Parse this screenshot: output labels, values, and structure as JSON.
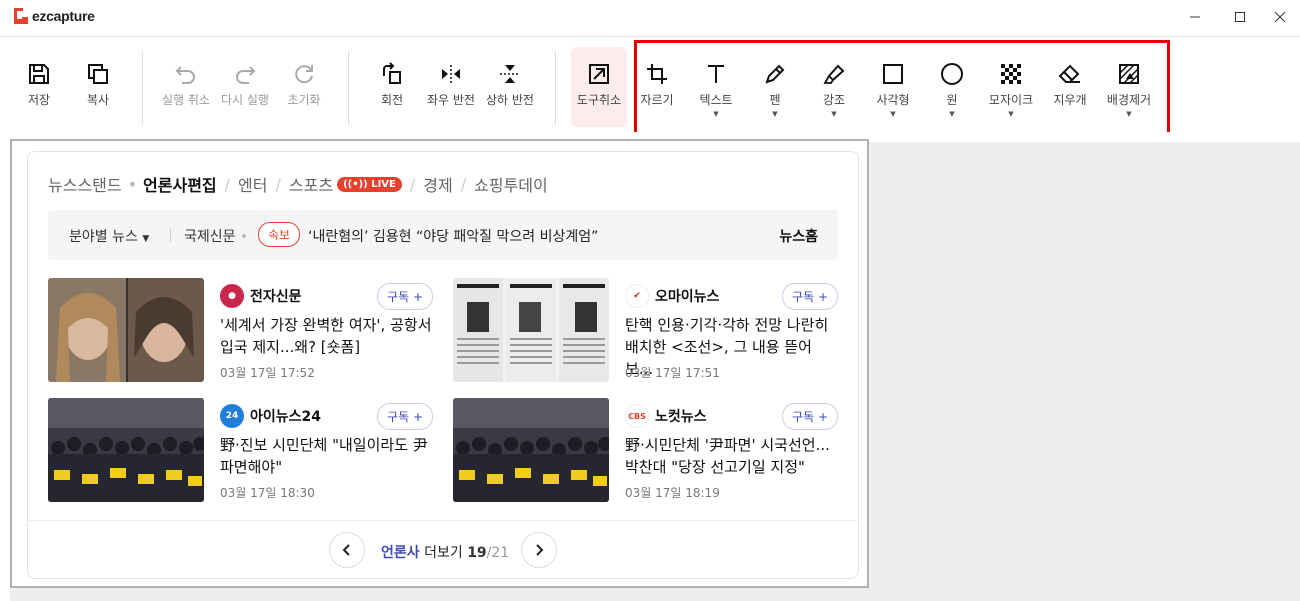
{
  "app": {
    "title": "ezcapture",
    "window_buttons": [
      "minimize-icon",
      "maximize-icon",
      "close-icon"
    ]
  },
  "toolbar": {
    "file_tools": [
      {
        "label": "저장",
        "icon": "save-icon",
        "enabled": true
      },
      {
        "label": "복사",
        "icon": "copy-icon",
        "enabled": true
      }
    ],
    "history_tools": [
      {
        "label": "실행 취소",
        "icon": "undo-icon",
        "enabled": false
      },
      {
        "label": "다시 실행",
        "icon": "redo-icon",
        "enabled": false
      },
      {
        "label": "초기화",
        "icon": "reset-icon",
        "enabled": false
      }
    ],
    "transform_tools": [
      {
        "label": "회전",
        "icon": "rotate-icon"
      },
      {
        "label": "좌우 반전",
        "icon": "flip-horizontal-icon"
      },
      {
        "label": "상하 반전",
        "icon": "flip-vertical-icon"
      }
    ],
    "cancel_tool": {
      "label": "도구취소",
      "icon": "cancel-tool-icon"
    },
    "edit_tools": [
      {
        "label": "자르기",
        "icon": "crop-icon",
        "dropdown": false
      },
      {
        "label": "텍스트",
        "icon": "text-icon",
        "dropdown": true
      },
      {
        "label": "펜",
        "icon": "pen-icon",
        "dropdown": true
      },
      {
        "label": "강조",
        "icon": "highlighter-icon",
        "dropdown": true
      },
      {
        "label": "사각형",
        "icon": "rectangle-icon",
        "dropdown": true
      },
      {
        "label": "원",
        "icon": "circle-icon",
        "dropdown": true
      },
      {
        "label": "모자이크",
        "icon": "mosaic-icon",
        "dropdown": true
      },
      {
        "label": "지우개",
        "icon": "eraser-icon",
        "dropdown": false
      },
      {
        "label": "배경제거",
        "icon": "remove-background-icon",
        "dropdown": true
      }
    ],
    "highlight_color": "#e60000"
  },
  "news": {
    "tabs": [
      "뉴스스탠드",
      "언론사편집",
      "엔터",
      "스포츠",
      "경제",
      "쇼핑투데이"
    ],
    "selected_tab": "언론사편집",
    "live_label": "LIVE",
    "field_news": "분야별 뉴스",
    "intl_paper": "국제신문",
    "breaking_label": "속보",
    "breaking_headline": "‘내란혐의’ 김용현 “야당 패악질 막으려 비상계엄”",
    "home_label": "뉴스홈",
    "subscribe_label": "구독 +",
    "items": [
      {
        "press": "전자신문",
        "title": "'세계서 가장 완벽한 여자', 공항서 입국 제지...왜? [숏폼]",
        "time": "03월 17일 17:52",
        "logo_color": "#c8264b"
      },
      {
        "press": "오마이뉴스",
        "title": "탄핵 인용·기각·각하 전망 나란히 배치한 <조선>, 그 내용 뜯어보...",
        "time": "03월 17일 17:51",
        "logo_color": "#d9251c"
      },
      {
        "press": "아이뉴스24",
        "title": "野·진보 시민단체 \"내일이라도 尹 파면해야\"",
        "time": "03월 17일 18:30",
        "logo_color": "#1f7fd8"
      },
      {
        "press": "노컷뉴스",
        "title": "野·시민단체 '尹파면' 시국선언... 박찬대 \"당장 선고기일 지정\"",
        "time": "03월 17일 18:19",
        "logo_color": "#e23b2e"
      }
    ],
    "pager": {
      "prefix": "언론사",
      "suffix": "더보기",
      "current": "19",
      "total": "/21"
    }
  }
}
